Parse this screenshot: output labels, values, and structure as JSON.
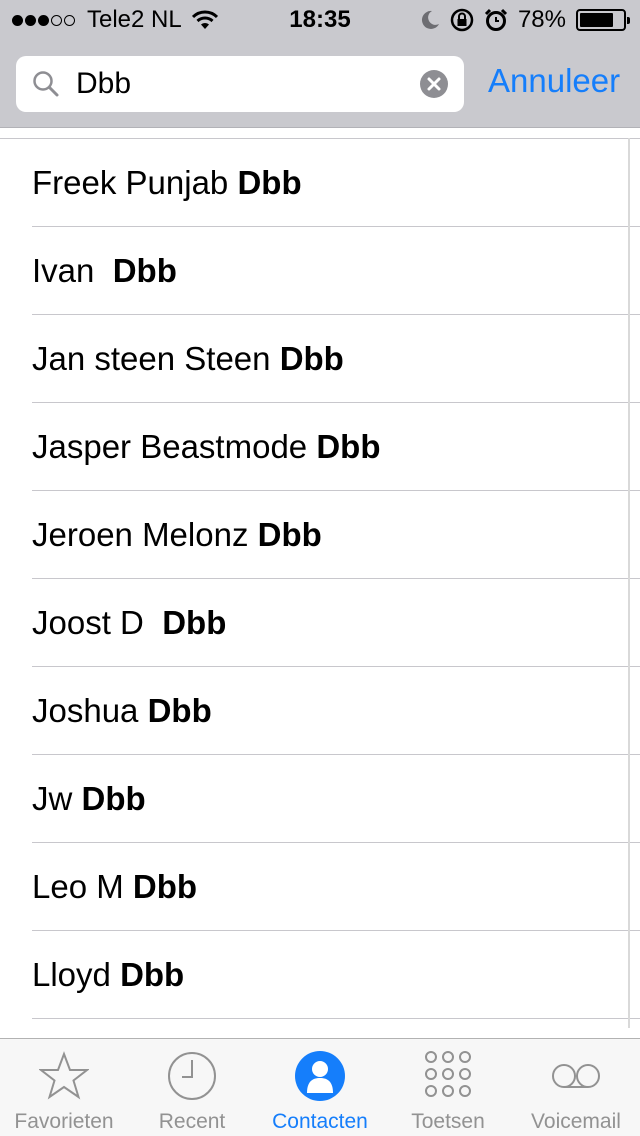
{
  "status_bar": {
    "carrier": "Tele2 NL",
    "time": "18:35",
    "battery": "78%",
    "battery_level": 0.78
  },
  "search": {
    "query": "Dbb",
    "cancel_label": "Annuleer"
  },
  "results": [
    {
      "first": "Freek Punjab ",
      "last": "Dbb"
    },
    {
      "first": "Ivan  ",
      "last": "Dbb"
    },
    {
      "first": "Jan steen Steen ",
      "last": "Dbb"
    },
    {
      "first": "Jasper Beastmode ",
      "last": "Dbb"
    },
    {
      "first": "Jeroen Melonz ",
      "last": "Dbb"
    },
    {
      "first": "Joost D  ",
      "last": "Dbb"
    },
    {
      "first": "Joshua ",
      "last": "Dbb"
    },
    {
      "first": "Jw ",
      "last": "Dbb"
    },
    {
      "first": "Leo M ",
      "last": "Dbb"
    },
    {
      "first": "Lloyd ",
      "last": "Dbb"
    }
  ],
  "tabbar": {
    "tabs": [
      {
        "label": "Favorieten",
        "icon": "star-icon"
      },
      {
        "label": "Recent",
        "icon": "clock-icon"
      },
      {
        "label": "Contacten",
        "icon": "contacts-icon",
        "active": true
      },
      {
        "label": "Toetsen",
        "icon": "keypad-icon"
      },
      {
        "label": "Voicemail",
        "icon": "voicemail-icon"
      }
    ]
  },
  "colors": {
    "accent": "#157efb",
    "header_bg": "#c9c9ce",
    "inactive_tab": "#929292"
  }
}
